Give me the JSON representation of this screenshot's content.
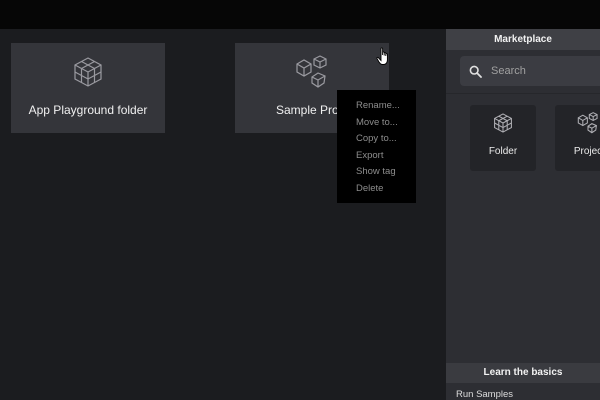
{
  "workspace": {
    "tiles": [
      {
        "label": "App Playground folder",
        "icon": "cube-grid-icon"
      },
      {
        "label": "Sample Proje",
        "icon": "cubes-icon"
      }
    ]
  },
  "context_menu": {
    "items": [
      "Rename...",
      "Move to...",
      "Copy to...",
      "Export",
      "Show tag",
      "Delete"
    ]
  },
  "sidepanel": {
    "marketplace_title": "Marketplace",
    "search": {
      "placeholder": "Search",
      "value": ""
    },
    "cards": [
      {
        "label": "Folder",
        "icon": "cube-grid-icon"
      },
      {
        "label": "Projec",
        "icon": "cubes-icon"
      }
    ],
    "learn_title": "Learn the basics",
    "learn_items": [
      "Run Samples"
    ]
  },
  "colors": {
    "background": "#1b1c1f",
    "tile": "#34353a",
    "panel": "#2d2e33",
    "menu": "#000000",
    "menu_text": "#8d8d8d"
  }
}
